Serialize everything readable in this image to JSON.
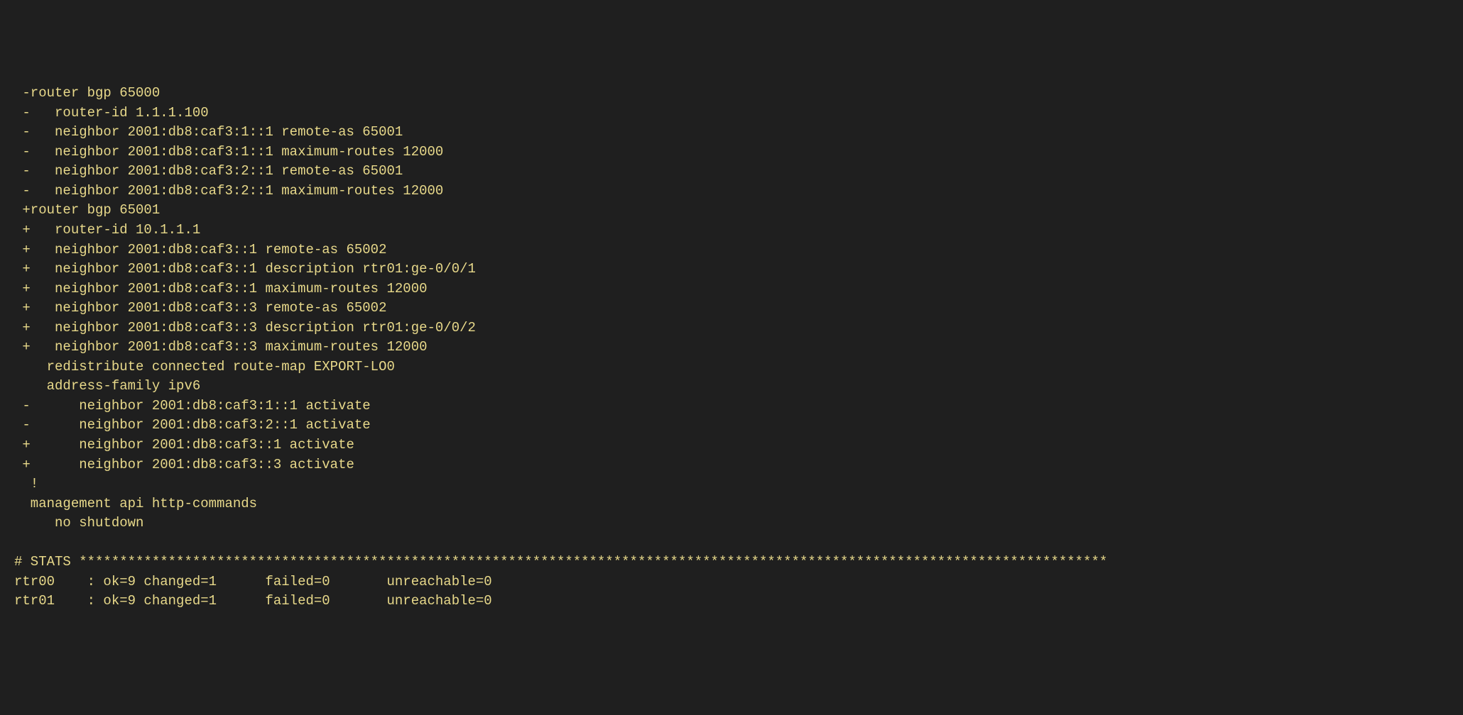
{
  "diff_lines": [
    " -router bgp 65000",
    " -   router-id 1.1.1.100",
    " -   neighbor 2001:db8:caf3:1::1 remote-as 65001",
    " -   neighbor 2001:db8:caf3:1::1 maximum-routes 12000",
    " -   neighbor 2001:db8:caf3:2::1 remote-as 65001",
    " -   neighbor 2001:db8:caf3:2::1 maximum-routes 12000",
    " +router bgp 65001",
    " +   router-id 10.1.1.1",
    " +   neighbor 2001:db8:caf3::1 remote-as 65002",
    " +   neighbor 2001:db8:caf3::1 description rtr01:ge-0/0/1",
    " +   neighbor 2001:db8:caf3::1 maximum-routes 12000",
    " +   neighbor 2001:db8:caf3::3 remote-as 65002",
    " +   neighbor 2001:db8:caf3::3 description rtr01:ge-0/0/2",
    " +   neighbor 2001:db8:caf3::3 maximum-routes 12000",
    "    redistribute connected route-map EXPORT-LO0",
    "    address-family ipv6",
    " -      neighbor 2001:db8:caf3:1::1 activate",
    " -      neighbor 2001:db8:caf3:2::1 activate",
    " +      neighbor 2001:db8:caf3::1 activate",
    " +      neighbor 2001:db8:caf3::3 activate",
    "  !",
    "  management api http-commands",
    "     no shutdown",
    "",
    "# STATS *******************************************************************************************************************************",
    "rtr00    : ok=9 changed=1      failed=0       unreachable=0",
    "rtr01    : ok=9 changed=1      failed=0       unreachable=0"
  ]
}
